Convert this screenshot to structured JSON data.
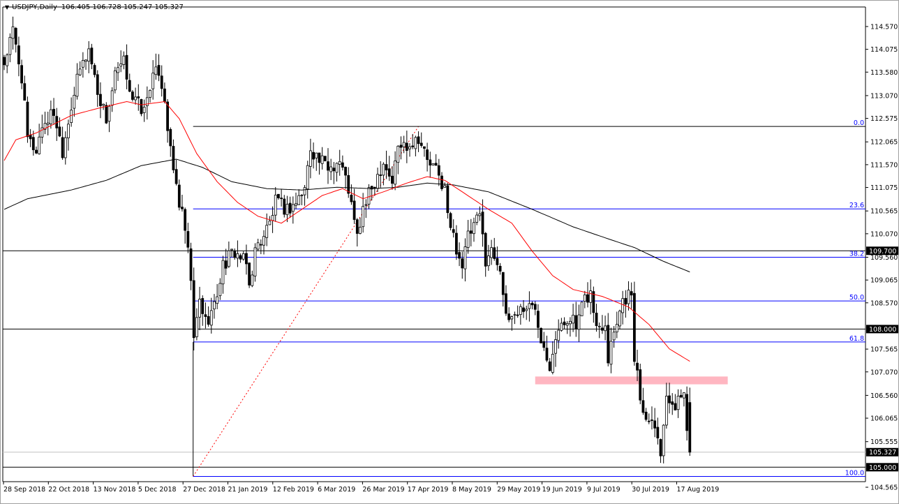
{
  "header": {
    "symbol_timeframe": "USDJPY,Daily",
    "ohlc": "106.405 106.728 105.247 105.327"
  },
  "colors": {
    "bull_fill": "#ffffff",
    "bear_fill": "#000000",
    "ma_fast": "#ff0000",
    "ma_slow": "#000000",
    "fib": "#0000ff",
    "zone": "#ffb6c1",
    "level": "#000000",
    "current": "#c0c0c0"
  },
  "chart_data": {
    "type": "candlestick",
    "title": "USDJPY,Daily",
    "ylim": [
      104.565,
      114.57
    ],
    "candle_count": 236,
    "close_path": [
      [
        0,
        113.78
      ],
      [
        3,
        114.46
      ],
      [
        6,
        113.48
      ],
      [
        8,
        112.11
      ],
      [
        11,
        111.89
      ],
      [
        13,
        112.42
      ],
      [
        17,
        112.72
      ],
      [
        20,
        111.89
      ],
      [
        23,
        112.87
      ],
      [
        26,
        113.63
      ],
      [
        29,
        114.08
      ],
      [
        32,
        113.18
      ],
      [
        35,
        112.57
      ],
      [
        38,
        113.48
      ],
      [
        41,
        113.78
      ],
      [
        44,
        113.02
      ],
      [
        48,
        112.72
      ],
      [
        50,
        113.33
      ],
      [
        53,
        113.63
      ],
      [
        55,
        113.02
      ],
      [
        57,
        111.81
      ],
      [
        60,
        110.75
      ],
      [
        62,
        110.14
      ],
      [
        64,
        109.08
      ],
      [
        65,
        107.72
      ],
      [
        67,
        108.63
      ],
      [
        69,
        108.17
      ],
      [
        72,
        108.48
      ],
      [
        75,
        109.39
      ],
      [
        79,
        109.69
      ],
      [
        83,
        109.39
      ],
      [
        84,
        108.93
      ],
      [
        86,
        109.69
      ],
      [
        91,
        110.3
      ],
      [
        93,
        110.75
      ],
      [
        97,
        110.6
      ],
      [
        100,
        110.75
      ],
      [
        103,
        111.05
      ],
      [
        105,
        111.96
      ],
      [
        108,
        111.66
      ],
      [
        111,
        111.51
      ],
      [
        115,
        111.66
      ],
      [
        118,
        111.05
      ],
      [
        120,
        110.3
      ],
      [
        121,
        109.99
      ],
      [
        123,
        110.6
      ],
      [
        126,
        111.05
      ],
      [
        128,
        111.36
      ],
      [
        130,
        111.66
      ],
      [
        133,
        111.2
      ],
      [
        135,
        111.96
      ],
      [
        139,
        112.04
      ],
      [
        142,
        112.19
      ],
      [
        145,
        111.66
      ],
      [
        148,
        111.43
      ],
      [
        151,
        111.05
      ],
      [
        152,
        110.45
      ],
      [
        154,
        109.99
      ],
      [
        157,
        109.39
      ],
      [
        159,
        109.99
      ],
      [
        163,
        110.45
      ],
      [
        165,
        109.54
      ],
      [
        167,
        109.69
      ],
      [
        170,
        109.39
      ],
      [
        172,
        108.17
      ],
      [
        175,
        108.33
      ],
      [
        178,
        108.48
      ],
      [
        182,
        108.48
      ],
      [
        184,
        107.87
      ],
      [
        187,
        107.26
      ],
      [
        189,
        107.87
      ],
      [
        191,
        108.02
      ],
      [
        194,
        108.33
      ],
      [
        196,
        108.02
      ],
      [
        199,
        108.63
      ],
      [
        201,
        108.78
      ],
      [
        203,
        108.02
      ],
      [
        206,
        108.17
      ],
      [
        207,
        107.42
      ],
      [
        209,
        108.02
      ],
      [
        212,
        108.63
      ],
      [
        214,
        108.78
      ],
      [
        215,
        108.63
      ],
      [
        216,
        107.42
      ],
      [
        218,
        106.51
      ],
      [
        220,
        106.05
      ],
      [
        222,
        106.2
      ],
      [
        224,
        105.6
      ],
      [
        225,
        105.3
      ],
      [
        226,
        106.05
      ],
      [
        227,
        106.66
      ],
      [
        229,
        106.2
      ],
      [
        231,
        106.51
      ],
      [
        233,
        106.58
      ],
      [
        235,
        105.33
      ]
    ],
    "ma_fast_path": [
      [
        0,
        111.66
      ],
      [
        4,
        112.11
      ],
      [
        11,
        112.26
      ],
      [
        23,
        112.64
      ],
      [
        32,
        112.79
      ],
      [
        42,
        112.94
      ],
      [
        47,
        112.87
      ],
      [
        55,
        112.94
      ],
      [
        60,
        112.57
      ],
      [
        66,
        111.81
      ],
      [
        73,
        111.2
      ],
      [
        80,
        110.75
      ],
      [
        87,
        110.45
      ],
      [
        95,
        110.3
      ],
      [
        102,
        110.6
      ],
      [
        109,
        110.9
      ],
      [
        116,
        111.05
      ],
      [
        123,
        110.83
      ],
      [
        130,
        110.98
      ],
      [
        138,
        111.17
      ],
      [
        145,
        111.31
      ],
      [
        151,
        111.23
      ],
      [
        157,
        110.98
      ],
      [
        166,
        110.6
      ],
      [
        174,
        110.3
      ],
      [
        181,
        109.69
      ],
      [
        188,
        109.16
      ],
      [
        195,
        108.86
      ],
      [
        205,
        108.71
      ],
      [
        214,
        108.48
      ],
      [
        221,
        108.1
      ],
      [
        228,
        107.57
      ],
      [
        235,
        107.3
      ]
    ],
    "ma_slow_path": [
      [
        0,
        110.6
      ],
      [
        8,
        110.83
      ],
      [
        23,
        111.02
      ],
      [
        35,
        111.23
      ],
      [
        47,
        111.55
      ],
      [
        59,
        111.69
      ],
      [
        68,
        111.51
      ],
      [
        78,
        111.2
      ],
      [
        90,
        111.05
      ],
      [
        102,
        111.02
      ],
      [
        114,
        111.08
      ],
      [
        126,
        111.05
      ],
      [
        135,
        111.08
      ],
      [
        145,
        111.17
      ],
      [
        154,
        111.13
      ],
      [
        166,
        110.98
      ],
      [
        181,
        110.6
      ],
      [
        195,
        110.22
      ],
      [
        207,
        109.96
      ],
      [
        216,
        109.77
      ],
      [
        226,
        109.47
      ],
      [
        235,
        109.24
      ]
    ],
    "y_ticks": [
      "114.570",
      "114.075",
      "113.580",
      "113.070",
      "112.575",
      "112.065",
      "111.570",
      "111.075",
      "110.565",
      "110.070",
      "109.560",
      "109.065",
      "108.570",
      "107.565",
      "107.070",
      "106.560",
      "106.065",
      "105.555",
      "104.565"
    ],
    "x_ticks": [
      "28 Sep 2018",
      "22 Oct 2018",
      "13 Nov 2018",
      "5 Dec 2018",
      "27 Dec 2018",
      "21 Jan 2019",
      "12 Feb 2019",
      "6 Mar 2019",
      "26 Mar 2019",
      "17 Apr 2019",
      "8 May 2019",
      "29 May 2019",
      "19 Jun 2019",
      "9 Jul 2019",
      "30 Jul 2019",
      "17 Aug 2019"
    ],
    "horizontal_levels": [
      {
        "label": "109.700",
        "price": 109.7
      },
      {
        "label": "108.000",
        "price": 108.0
      },
      {
        "label": "105.000",
        "price": 105.0
      }
    ],
    "current_price": {
      "label": "105.327",
      "price": 105.327
    },
    "fibonacci": {
      "start_index": 65,
      "end_index": 142,
      "high": 112.4,
      "low": 104.8,
      "levels": [
        {
          "label": "0.0",
          "price": 112.4
        },
        {
          "label": "23.6",
          "price": 110.61
        },
        {
          "label": "38.2",
          "price": 109.56
        },
        {
          "label": "50.0",
          "price": 108.61
        },
        {
          "label": "61.8",
          "price": 107.72
        },
        {
          "label": "100.0",
          "price": 104.8
        }
      ]
    },
    "zone": {
      "from_index": 182,
      "to_index": 248,
      "top": 106.97,
      "bottom": 106.8
    }
  }
}
